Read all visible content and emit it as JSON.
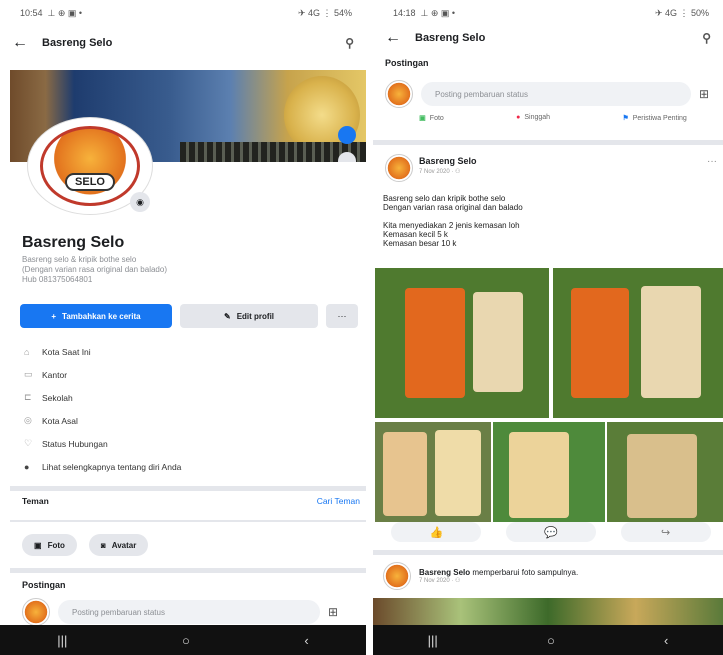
{
  "left": {
    "status_time": "10:54",
    "status_icons": "⊥ ⊕ ▣ •",
    "status_right": "✈ 4G ⋮ 54%",
    "title": "Basreng Selo",
    "logo_text": "SELO",
    "name": "Basreng Selo",
    "bio": [
      "Basreng selo & kripik bothe selo",
      "(Dengan varian rasa original dan balado)",
      "Hub 081375064801"
    ],
    "add_story_label": "Tambahkan ke cerita",
    "edit_profile_label": "Edit profil",
    "more_label": "···",
    "details": [
      {
        "icon": "⌂",
        "label": "Kota Saat Ini"
      },
      {
        "icon": "▭",
        "label": "Kantor"
      },
      {
        "icon": "⊏",
        "label": "Sekolah"
      },
      {
        "icon": "◎",
        "label": "Kota Asal"
      },
      {
        "icon": "♡",
        "label": "Status Hubungan"
      },
      {
        "icon": "●",
        "label": "Lihat selengkapnya tentang diri Anda"
      }
    ],
    "friends_title": "Teman",
    "find_friends": "Cari Teman",
    "chip_photo": "Foto",
    "chip_avatar": "Avatar",
    "posts_title": "Postingan",
    "composer_placeholder": "Posting pembaruan status"
  },
  "right": {
    "status_time": "14:18",
    "status_icons": "⊥ ⊕ ▣ •",
    "status_right": "✈ 4G ⋮ 50%",
    "title": "Basreng Selo",
    "posts_title": "Postingan",
    "composer_placeholder": "Posting pembaruan status",
    "actions": [
      "Foto",
      "Singgah",
      "Peristiwa Penting"
    ],
    "post": {
      "author": "Basreng Selo",
      "time": "7 Nov 2020 · ⚇",
      "lines": [
        "Basreng selo dan kripik bothe selo",
        "Dengan varian rasa original dan balado",
        "Kita menyediakan 2 jenis kemasan loh",
        "Kemasan kecil 5 k",
        "Kemasan besar 10 k"
      ]
    },
    "post2_author": "Basreng Selo",
    "post2_text": " memperbarui foto sampulnya.",
    "post2_time": "7 Nov 2020 · ⚇"
  },
  "nav": {
    "recent": "|||",
    "home": "○",
    "back": "‹"
  }
}
